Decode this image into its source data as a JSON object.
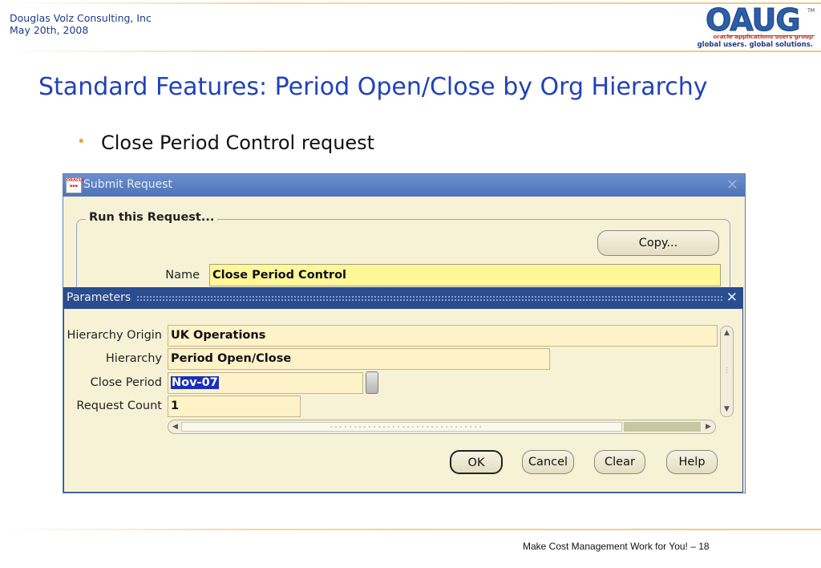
{
  "header": {
    "company": "Douglas Volz Consulting, Inc",
    "date": "May 20th, 2008",
    "logo": {
      "wordmark": "OAUG",
      "trademark": "TM",
      "subtitle": "oracle applications users group",
      "tagline": "global users. global solutions."
    }
  },
  "slide": {
    "title": "Standard Features:  Period Open/Close by Org Hierarchy",
    "bullet": "Close Period Control request"
  },
  "submit_window": {
    "title": "Submit Request",
    "group_label": "Run this Request...",
    "copy_button": "Copy...",
    "name_label": "Name",
    "name_value": "Close Period Control"
  },
  "parameters_window": {
    "title": "Parameters",
    "fields": [
      {
        "label": "Hierarchy Origin",
        "value": "UK Operations"
      },
      {
        "label": "Hierarchy",
        "value": "Period Open/Close"
      },
      {
        "label": "Close Period",
        "value": "Nov-07"
      },
      {
        "label": "Request Count",
        "value": "1"
      }
    ],
    "buttons": {
      "ok": "OK",
      "cancel": "Cancel",
      "clear": "Clear",
      "help": "Help"
    }
  },
  "footer": {
    "text": "Make Cost Management Work for You! – 18"
  },
  "colors": {
    "title_blue": "#2142b8",
    "titlebar_blue": "#4d74b8",
    "param_titlebar": "#2a4d8f",
    "field_yellow": "#fdf79a",
    "selection_blue": "#1b2fb8",
    "bullet_orange": "#e8a33a"
  },
  "icons": [
    "oracle-forms-icon",
    "close-icon",
    "scroll-up-icon",
    "scroll-down-icon",
    "scroll-left-icon",
    "scroll-right-icon",
    "lov-button-icon"
  ]
}
